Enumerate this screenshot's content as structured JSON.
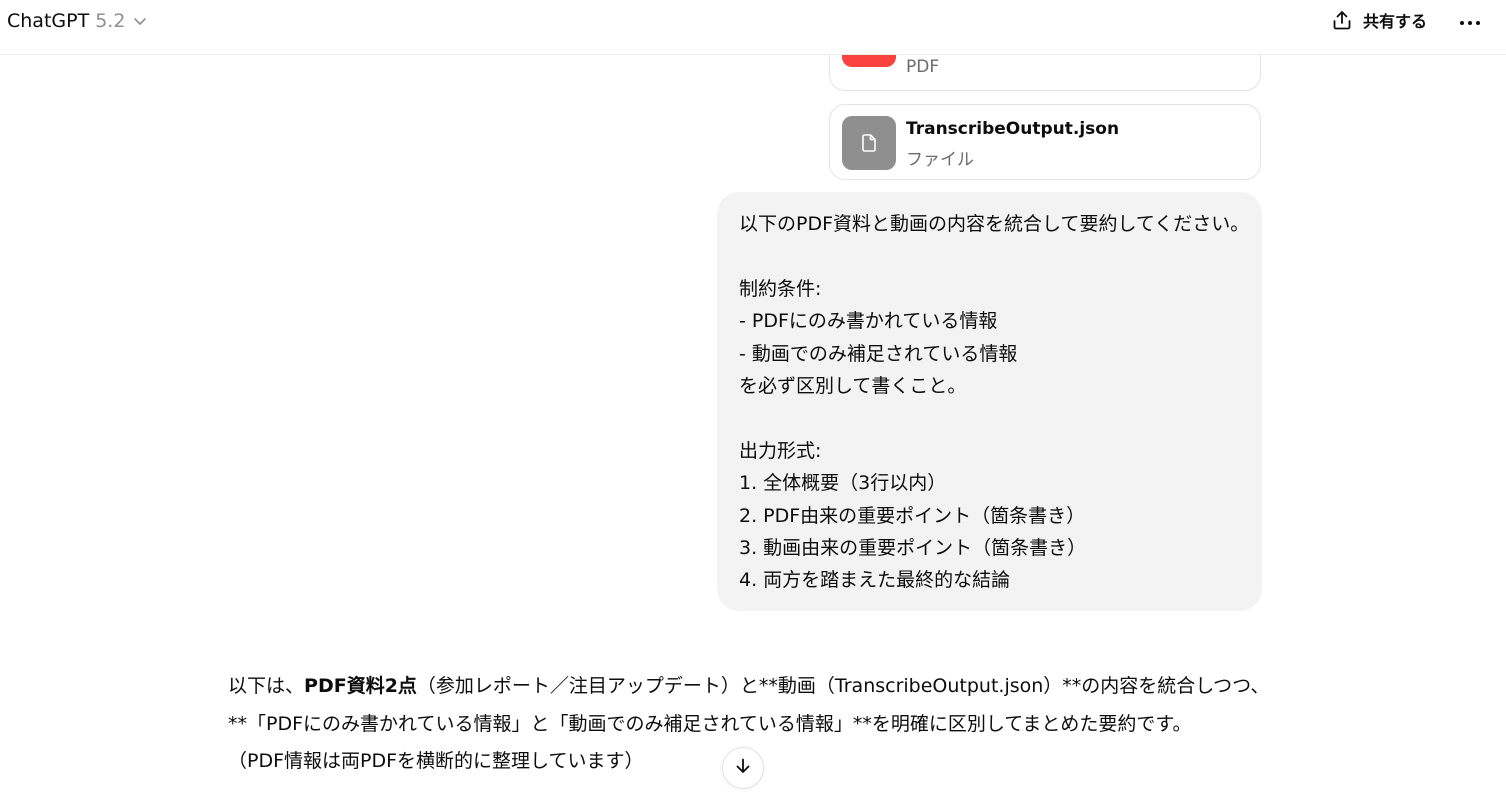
{
  "header": {
    "app_name": "ChatGPT",
    "model_version": "5.2",
    "share_label": "共有する",
    "icons": {
      "chevron": "chevron-down-icon",
      "share": "share-icon",
      "more": "more-horizontal-icon"
    }
  },
  "attachments": [
    {
      "name": "",
      "type": "PDF",
      "icon": "pdf-file-icon",
      "color": "#fa423e"
    },
    {
      "name": "TranscribeOutput.json",
      "type": "ファイル",
      "icon": "file-icon",
      "color": "#8f8f8f"
    }
  ],
  "user_message": {
    "lines": [
      "以下のPDF資料と動画の内容を統合して要約してください。",
      "",
      "制約条件:",
      "- PDFにのみ書かれている情報",
      "- 動画でのみ補足されている情報",
      "を必ず区別して書くこと。",
      "",
      "出力形式:",
      "1. 全体概要（3行以内）",
      "2. PDF由来の重要ポイント（箇条書き）",
      "3. 動画由来の重要ポイント（箇条書き）",
      "4. 両方を踏まえた最終的な結論"
    ]
  },
  "assistant_message": {
    "line1_prefix": "以下は、",
    "line1_bold": "PDF資料2点",
    "line1_suffix": "（参加レポート／注目アップデート）と**動画（TranscribeOutput.json）**の内容を統合しつつ、",
    "line2": "**「PDFにのみ書かれている情報」と「動画でのみ補足されている情報」**を明確に区別してまとめた要約です。",
    "line3": "（PDF情報は両PDFを横断的に整理しています）"
  },
  "scroll_button": {
    "icon": "arrow-down-icon"
  },
  "colors": {
    "pdf_accent": "#fa423e",
    "file_accent": "#8f8f8f",
    "bubble_bg": "#f3f3f3",
    "muted_text": "#8f8f8f"
  }
}
